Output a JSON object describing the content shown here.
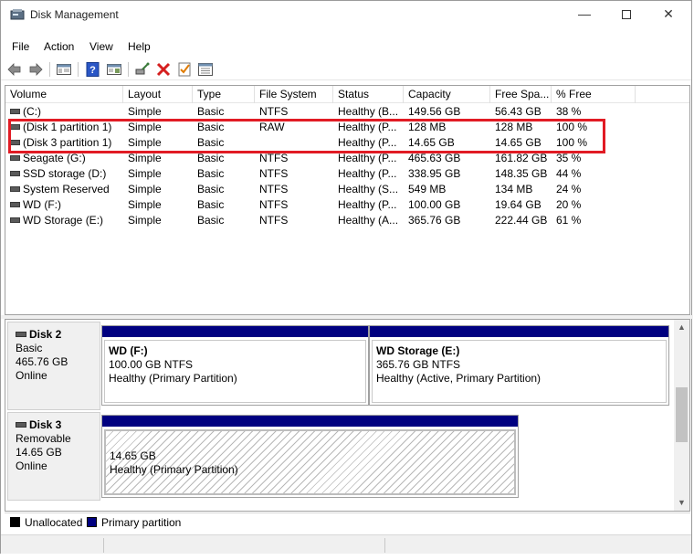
{
  "window": {
    "title": "Disk Management",
    "min_glyph": "—",
    "close_glyph": "✕"
  },
  "menu": [
    "File",
    "Action",
    "View",
    "Help"
  ],
  "table": {
    "columns": [
      "Volume",
      "Layout",
      "Type",
      "File System",
      "Status",
      "Capacity",
      "Free Spa...",
      "% Free"
    ],
    "rows": [
      [
        "(C:)",
        "Simple",
        "Basic",
        "NTFS",
        "Healthy (B...",
        "149.56 GB",
        "56.43 GB",
        "38 %"
      ],
      [
        "(Disk 1 partition 1)",
        "Simple",
        "Basic",
        "RAW",
        "Healthy (P...",
        "128 MB",
        "128 MB",
        "100 %"
      ],
      [
        "(Disk 3 partition 1)",
        "Simple",
        "Basic",
        "",
        "Healthy (P...",
        "14.65 GB",
        "14.65 GB",
        "100 %"
      ],
      [
        "Seagate (G:)",
        "Simple",
        "Basic",
        "NTFS",
        "Healthy (P...",
        "465.63 GB",
        "161.82 GB",
        "35 %"
      ],
      [
        "SSD storage (D:)",
        "Simple",
        "Basic",
        "NTFS",
        "Healthy (P...",
        "338.95 GB",
        "148.35 GB",
        "44 %"
      ],
      [
        "System Reserved",
        "Simple",
        "Basic",
        "NTFS",
        "Healthy (S...",
        "549 MB",
        "134 MB",
        "24 %"
      ],
      [
        "WD (F:)",
        "Simple",
        "Basic",
        "NTFS",
        "Healthy (P...",
        "100.00 GB",
        "19.64 GB",
        "20 %"
      ],
      [
        "WD Storage (E:)",
        "Simple",
        "Basic",
        "NTFS",
        "Healthy (A...",
        "365.76 GB",
        "222.44 GB",
        "61 %"
      ]
    ]
  },
  "disks": [
    {
      "name": "Disk 2",
      "type": "Basic",
      "size": "465.76 GB",
      "status": "Online",
      "partitions": [
        {
          "title": "WD  (F:)",
          "size": "100.00 GB NTFS",
          "status": "Healthy (Primary Partition)"
        },
        {
          "title": "WD Storage  (E:)",
          "size": "365.76 GB NTFS",
          "status": "Healthy (Active, Primary Partition)"
        }
      ]
    },
    {
      "name": "Disk 3",
      "type": "Removable",
      "size": "14.65 GB",
      "status": "Online",
      "partitions": [
        {
          "title": "",
          "size": "14.65 GB",
          "status": "Healthy (Primary Partition)"
        }
      ]
    }
  ],
  "legend": [
    {
      "label": "Unallocated",
      "color": "#000000"
    },
    {
      "label": "Primary partition",
      "color": "#000080"
    }
  ],
  "colors": {
    "highlight": "#e11b24",
    "partition_bar": "#000080"
  }
}
